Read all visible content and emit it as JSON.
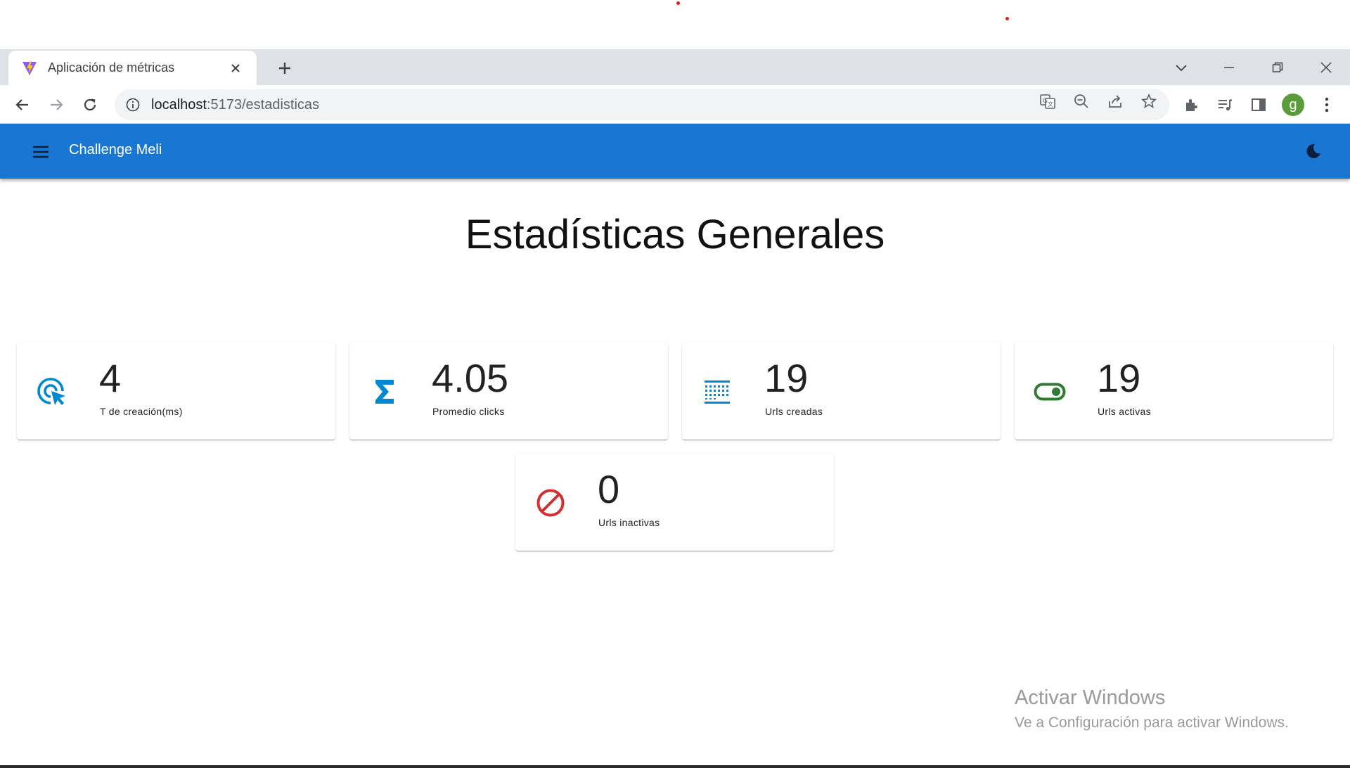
{
  "browser": {
    "tab_title": "Aplicación de métricas",
    "url_host": "localhost",
    "url_path": ":5173/estadisticas"
  },
  "app": {
    "title": "Challenge Meli",
    "colors": {
      "primary": "#1976d2",
      "icon_blue": "#0288d1",
      "icon_green": "#2e7d32",
      "icon_red": "#d32f2f"
    }
  },
  "page": {
    "heading": "Estadísticas Generales"
  },
  "stats": [
    {
      "value": "4",
      "label": "T de creación(ms)",
      "icon": "ads-click-icon"
    },
    {
      "value": "4.05",
      "label": "Promedio clicks",
      "icon": "sigma-icon"
    },
    {
      "value": "19",
      "label": "Urls creadas",
      "icon": "grid-dots-icon"
    },
    {
      "value": "19",
      "label": "Urls activas",
      "icon": "toggle-on-icon"
    },
    {
      "value": "0",
      "label": "Urls inactivas",
      "icon": "block-icon"
    }
  ],
  "watermark": {
    "title": "Activar Windows",
    "subtitle": "Ve a Configuración para activar Windows."
  },
  "profile": {
    "initial": "g"
  }
}
